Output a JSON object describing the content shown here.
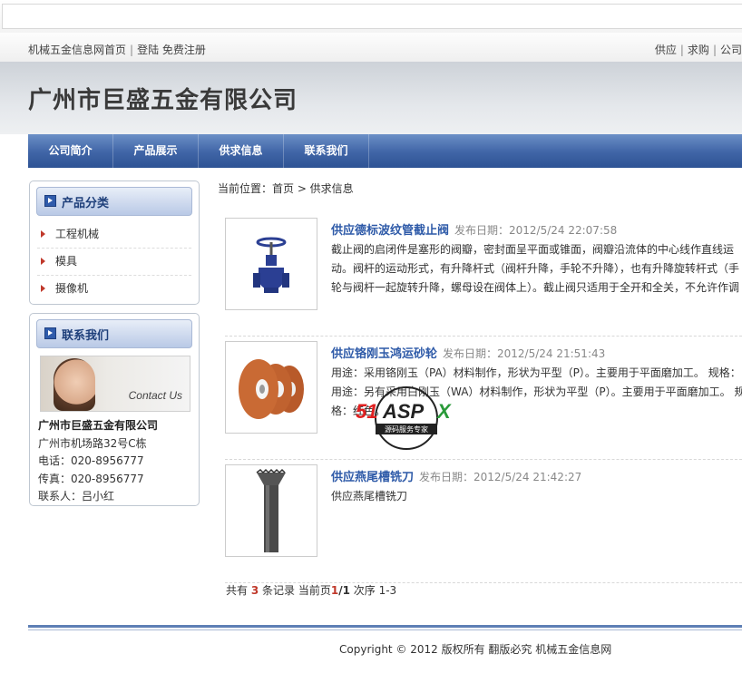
{
  "toplinks": {
    "site_home": "机械五金信息网首页",
    "sep": "|",
    "login": "登陆",
    "register": "免费注册",
    "right_items": [
      "供应",
      "求购",
      "公司"
    ]
  },
  "header": {
    "company_name": "广州市巨盛五金有限公司"
  },
  "nav": {
    "items": [
      "公司简介",
      "产品展示",
      "供求信息",
      "联系我们"
    ]
  },
  "sidebar": {
    "category_title": "产品分类",
    "categories": [
      "工程机械",
      "模具",
      "摄像机"
    ],
    "contact_title": "联系我们",
    "contact_image_text": "Contact Us",
    "contact": {
      "company": "广州市巨盛五金有限公司",
      "address": "广州市机场路32号C栋",
      "phone": "电话：020-8956777",
      "fax": "传真：020-8956777",
      "person": "联系人：吕小红"
    }
  },
  "main": {
    "breadcrumb": "当前位置：首页 > 供求信息",
    "items": [
      {
        "title": "供应德标波纹管截止阀",
        "date": "发布日期：2012/5/24 22:07:58",
        "desc": "截止阀的启闭件是塞形的阀瓣，密封面呈平面或锥面，阀瓣沿流体的中心线作直线运动。阀杆的运动形式，有升降杆式（阀杆升降，手轮不升降），也有升降旋转杆式（手轮与阀杆一起旋转升降，螺母设在阀体上）。截止阀只适用于全开和全关，不允许作调节和节流。"
      },
      {
        "title": "供应铬刚玉鸿运砂轮",
        "date": "发布日期：2012/5/24 21:51:43",
        "desc": "用途：采用铬刚玉（PA）材料制作，形状为平型（P）。主要用于平面磨加工。 规格：用途：另有采用白刚玉（WA）材料制作，形状为平型（P）。主要用于平面磨加工。 规格：红色。"
      },
      {
        "title": "供应燕尾槽铣刀",
        "date": "发布日期：2012/5/24 21:42:27",
        "desc": "供应燕尾槽铣刀"
      }
    ],
    "pager": {
      "prefix": "共有",
      "total": "3",
      "mid": "条记录 当前页",
      "current": "1",
      "slash_total": "/1",
      "suffix": "次序 1-3"
    }
  },
  "footer": {
    "copyright": "Copyright © 2012 版权所有 翻版必究 机械五金信息网"
  },
  "watermark": {
    "logo_text": "51ASPX",
    "sub_text": "源码服务专家"
  },
  "colors": {
    "nav": "#3f64a6",
    "link": "#2e5aa8",
    "accent_red": "#c0392b"
  }
}
